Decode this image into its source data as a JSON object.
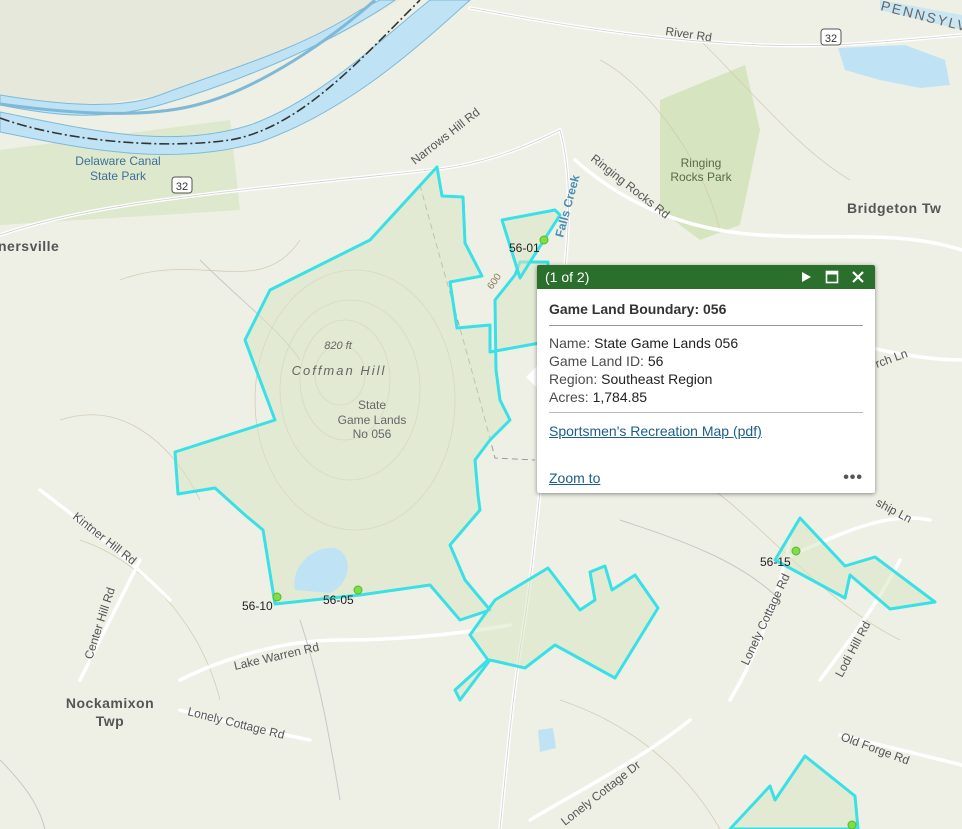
{
  "map": {
    "road_labels": [
      {
        "id": "river-rd",
        "text": "River Rd"
      },
      {
        "id": "narrows-hill-rd",
        "text": "Narrows Hill Rd"
      },
      {
        "id": "ringing-rocks-rd",
        "text": "Ringing Rocks Rd"
      },
      {
        "id": "falls-creek",
        "text": "Falls Creek"
      },
      {
        "id": "kintner-hill-rd",
        "text": "Kintner Hill Rd"
      },
      {
        "id": "center-hill-rd",
        "text": "Center Hill Rd"
      },
      {
        "id": "lake-warren-rd",
        "text": "Lake Warren Rd"
      },
      {
        "id": "lonely-cottage-rd-w",
        "text": "Lonely Cottage Rd"
      },
      {
        "id": "lonely-cottage-dr",
        "text": "Lonely Cottage Dr"
      },
      {
        "id": "lonely-cottage-rd-e",
        "text": "Lonely Cottage Rd"
      },
      {
        "id": "lodi-hill-rd",
        "text": "Lodi Hill Rd"
      },
      {
        "id": "old-forge-rd",
        "text": "Old Forge Rd"
      },
      {
        "id": "ship-ln",
        "text": "ship Ln"
      },
      {
        "id": "rch-ln",
        "text": "rch Ln"
      }
    ],
    "route_shields": [
      "32",
      "32"
    ],
    "place_labels": {
      "delaware_canal": [
        "Delaware Canal",
        "State Park"
      ],
      "ringing_rocks": [
        "Ringing",
        "Rocks Park"
      ],
      "bridgeton": "Bridgeton Tw",
      "nersville": "nersville",
      "nockamixon": [
        "Nockamixon",
        "Twp"
      ],
      "state_line": "PENNSYLV",
      "coffman_hill": "Coffman Hill",
      "elevation": "820 ft",
      "contour_600": "600",
      "state_game_lands": [
        "State",
        "Game Lands",
        "No 056"
      ]
    },
    "markers": [
      {
        "id": "56-01",
        "label": "56-01"
      },
      {
        "id": "56-10",
        "label": "56-10"
      },
      {
        "id": "56-05",
        "label": "56-05"
      },
      {
        "id": "56-15",
        "label": "56-15"
      }
    ],
    "colors": {
      "boundary": "#39e0e6",
      "marker": "#7be046",
      "land_fill": "#d9e6c4",
      "water": "#bfe3f5",
      "popup_header": "#2b6f2c"
    }
  },
  "popup": {
    "count": "(1 of 2)",
    "title": "Game Land Boundary: 056",
    "attributes": [
      {
        "label": "Name:",
        "value": "State Game Lands 056"
      },
      {
        "label": "Game Land ID:",
        "value": "56"
      },
      {
        "label": "Region:",
        "value": "Southeast Region"
      },
      {
        "label": "Acres:",
        "value": "1,784.85"
      }
    ],
    "link_text": "Sportsmen's Recreation Map (pdf)",
    "zoom_text": "Zoom to",
    "more_text": "•••",
    "icons": [
      "next-icon",
      "maximize-icon",
      "close-icon",
      "more-icon"
    ]
  }
}
